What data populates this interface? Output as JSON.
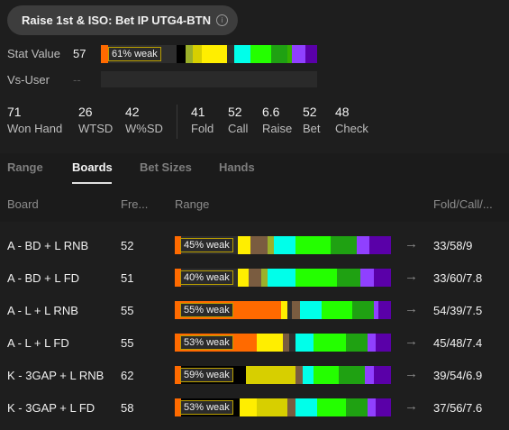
{
  "header": {
    "title": "Raise 1st & ISO: Bet IP UTG4-BTN",
    "info_icon": "info-icon"
  },
  "stat_value": {
    "label": "Stat Value",
    "value": "57",
    "weak_label": "61% weak",
    "segments": [
      {
        "color": "#ff6a00",
        "pct": 3
      },
      {
        "color": "#2e2e2e",
        "pct": 30
      },
      {
        "color": "#000000",
        "pct": 4
      },
      {
        "color": "#7a5c40",
        "pct": 0
      },
      {
        "color": "#9bb02a",
        "pct": 3
      },
      {
        "color": "#d7cf00",
        "pct": 4
      },
      {
        "color": "#ffee00",
        "pct": 11
      },
      {
        "color": "#f2e700",
        "pct": 0
      },
      {
        "color": "#2e2e2e",
        "pct": 3
      },
      {
        "color": "#00ffea",
        "pct": 7
      },
      {
        "color": "#24ff00",
        "pct": 9
      },
      {
        "color": "#1fa112",
        "pct": 7
      },
      {
        "color": "#35b000",
        "pct": 2
      },
      {
        "color": "#9040ff",
        "pct": 6
      },
      {
        "color": "#5a00a8",
        "pct": 5
      }
    ]
  },
  "vs_user": {
    "label": "Vs-User",
    "value": "--"
  },
  "stats_left": [
    {
      "num": "71",
      "label": "Won Hand"
    },
    {
      "num": "26",
      "label": "WTSD"
    },
    {
      "num": "42",
      "label": "W%SD"
    }
  ],
  "stats_right": [
    {
      "num": "41",
      "label": "Fold"
    },
    {
      "num": "52",
      "label": "Call"
    },
    {
      "num": "6.6",
      "label": "Raise"
    },
    {
      "num": "52",
      "label": "Bet"
    },
    {
      "num": "48",
      "label": "Check"
    }
  ],
  "tabs": [
    "Range",
    "Boards",
    "Bet Sizes",
    "Hands"
  ],
  "active_tab": "Boards",
  "table": {
    "headers": {
      "board": "Board",
      "freq": "Fre...",
      "range": "Range",
      "fcr": "Fold/Call/..."
    },
    "rows": [
      {
        "board": "A - BD + L RNB",
        "freq": "52",
        "weak": "45% weak",
        "fcr": "33/58/9",
        "segments": [
          {
            "color": "#ff6a00",
            "pct": 3
          },
          {
            "color": "#2e2e2e",
            "pct": 26
          },
          {
            "color": "#ffee00",
            "pct": 6
          },
          {
            "color": "#7a5c40",
            "pct": 8
          },
          {
            "color": "#9bb02a",
            "pct": 3
          },
          {
            "color": "#00ffea",
            "pct": 10
          },
          {
            "color": "#24ff00",
            "pct": 16
          },
          {
            "color": "#1fa112",
            "pct": 12
          },
          {
            "color": "#9040ff",
            "pct": 6
          },
          {
            "color": "#5a00a8",
            "pct": 10
          }
        ]
      },
      {
        "board": "A - BD + L FD",
        "freq": "51",
        "weak": "40% weak",
        "fcr": "33/60/7.8",
        "segments": [
          {
            "color": "#ff6a00",
            "pct": 3
          },
          {
            "color": "#2e2e2e",
            "pct": 26
          },
          {
            "color": "#ffee00",
            "pct": 5
          },
          {
            "color": "#7a5c40",
            "pct": 6
          },
          {
            "color": "#9bb02a",
            "pct": 3
          },
          {
            "color": "#00ffea",
            "pct": 13
          },
          {
            "color": "#24ff00",
            "pct": 19
          },
          {
            "color": "#1fa112",
            "pct": 11
          },
          {
            "color": "#9040ff",
            "pct": 6
          },
          {
            "color": "#5a00a8",
            "pct": 8
          }
        ]
      },
      {
        "board": "A - L + L RNB",
        "freq": "55",
        "weak": "55% weak",
        "fcr": "54/39/7.5",
        "segments": [
          {
            "color": "#ff6a00",
            "pct": 49
          },
          {
            "color": "#ffee00",
            "pct": 3
          },
          {
            "color": "#2e2e2e",
            "pct": 2
          },
          {
            "color": "#7a5c40",
            "pct": 4
          },
          {
            "color": "#00ffea",
            "pct": 10
          },
          {
            "color": "#24ff00",
            "pct": 14
          },
          {
            "color": "#1fa112",
            "pct": 10
          },
          {
            "color": "#9040ff",
            "pct": 2
          },
          {
            "color": "#5a00a8",
            "pct": 6
          }
        ]
      },
      {
        "board": "A - L + L FD",
        "freq": "55",
        "weak": "53% weak",
        "fcr": "45/48/7.4",
        "segments": [
          {
            "color": "#ff6a00",
            "pct": 38
          },
          {
            "color": "#ffee00",
            "pct": 12
          },
          {
            "color": "#7a5c40",
            "pct": 3
          },
          {
            "color": "#2e2e2e",
            "pct": 3
          },
          {
            "color": "#00ffea",
            "pct": 8
          },
          {
            "color": "#24ff00",
            "pct": 15
          },
          {
            "color": "#1fa112",
            "pct": 10
          },
          {
            "color": "#9040ff",
            "pct": 4
          },
          {
            "color": "#5a00a8",
            "pct": 7
          }
        ]
      },
      {
        "board": "K - 3GAP + L RNB",
        "freq": "62",
        "weak": "59% weak",
        "fcr": "39/54/6.9",
        "segments": [
          {
            "color": "#ff6a00",
            "pct": 3
          },
          {
            "color": "#000000",
            "pct": 30
          },
          {
            "color": "#d7cf00",
            "pct": 23
          },
          {
            "color": "#7a5c40",
            "pct": 3
          },
          {
            "color": "#00ffea",
            "pct": 5
          },
          {
            "color": "#24ff00",
            "pct": 12
          },
          {
            "color": "#1fa112",
            "pct": 12
          },
          {
            "color": "#9040ff",
            "pct": 4
          },
          {
            "color": "#5a00a8",
            "pct": 8
          }
        ]
      },
      {
        "board": "K - 3GAP + L FD",
        "freq": "58",
        "weak": "53% weak",
        "fcr": "37/56/7.6",
        "segments": [
          {
            "color": "#ff6a00",
            "pct": 3
          },
          {
            "color": "#000000",
            "pct": 27
          },
          {
            "color": "#ffee00",
            "pct": 8
          },
          {
            "color": "#d7cf00",
            "pct": 14
          },
          {
            "color": "#7a5c40",
            "pct": 4
          },
          {
            "color": "#00ffea",
            "pct": 10
          },
          {
            "color": "#24ff00",
            "pct": 13
          },
          {
            "color": "#1fa112",
            "pct": 10
          },
          {
            "color": "#9040ff",
            "pct": 4
          },
          {
            "color": "#5a00a8",
            "pct": 7
          }
        ]
      }
    ]
  }
}
